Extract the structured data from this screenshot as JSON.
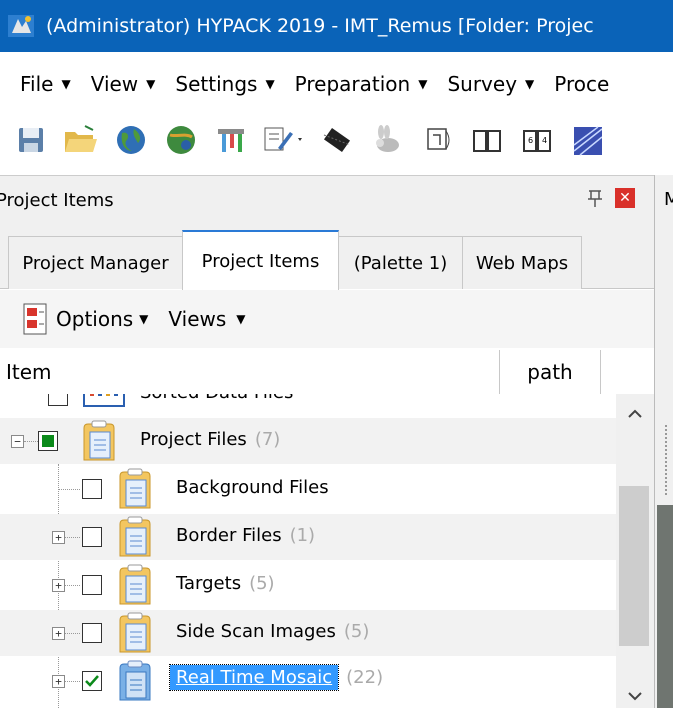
{
  "window": {
    "title": "(Administrator) HYPACK 2019 - IMT_Remus  [Folder: Projec"
  },
  "menubar": [
    "File",
    "View",
    "Settings",
    "Preparation",
    "Survey",
    "Proce"
  ],
  "toolbar": {
    "icons": [
      "save-icon",
      "open-folder-icon",
      "globe-icon",
      "sphere-icon",
      "network-icon",
      "edit-pen-icon",
      "chip-icon",
      "rabbit-icon",
      "monitor-icon",
      "book-icon",
      "book-64-icon",
      "wave-icon"
    ]
  },
  "panel": {
    "title": "Project Items",
    "partial_right_tab": "M",
    "tabs": [
      "Project Manager",
      "Project Items",
      "(Palette 1)",
      "Web Maps"
    ],
    "active_tab": 1,
    "options_label": "Options",
    "views_label": "Views"
  },
  "columns": {
    "item": "Item",
    "path": "path"
  },
  "tree": {
    "partial_top": "Sorted Data Files",
    "project_files": {
      "label": "Project Files",
      "count": "(7)"
    },
    "children": [
      {
        "label": "Background Files",
        "count": "",
        "expander": false,
        "checked": false
      },
      {
        "label": "Border Files",
        "count": "(1)",
        "expander": true,
        "checked": false
      },
      {
        "label": "Targets",
        "count": "(5)",
        "expander": true,
        "checked": false
      },
      {
        "label": "Side Scan Images",
        "count": "(5)",
        "expander": true,
        "checked": false
      },
      {
        "label": "Real Time Mosaic",
        "count": "(22)",
        "expander": true,
        "checked": true,
        "selected": true
      }
    ]
  },
  "colors": {
    "titlebar": "#0a63b8",
    "selection": "#3399ff",
    "close": "#d9302a"
  }
}
